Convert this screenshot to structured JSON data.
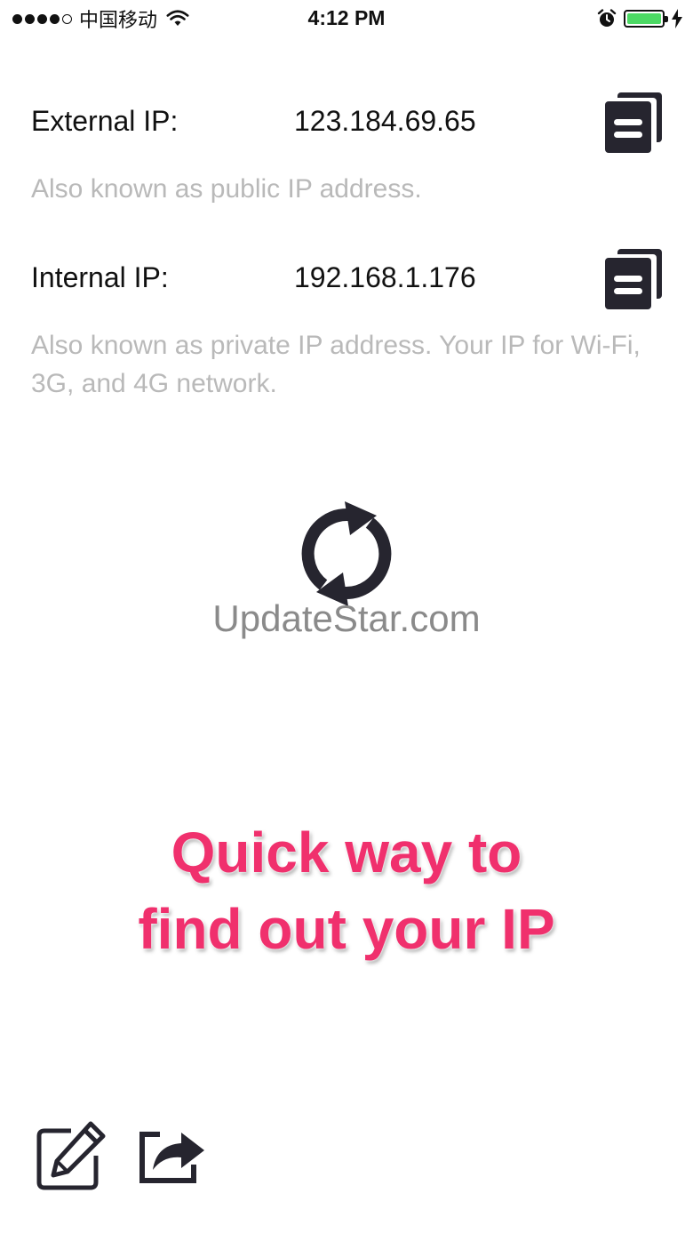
{
  "status_bar": {
    "carrier": "中国移动",
    "time": "4:12 PM",
    "signal_icon": "signal-dots-icon",
    "wifi_icon": "wifi-icon",
    "alarm_icon": "alarm-icon",
    "battery_icon": "battery-icon",
    "charging_icon": "charging-bolt-icon",
    "battery_color": "#4cd964"
  },
  "external": {
    "label": "External IP:",
    "value": "123.184.69.65",
    "description": "Also known as public IP address.",
    "copy_icon": "copy-icon"
  },
  "internal": {
    "label": "Internal IP:",
    "value": "192.168.1.176",
    "description": "Also known as private IP address. Your IP for Wi-Fi, 3G, and 4G network.",
    "copy_icon": "copy-icon"
  },
  "refresh_icon": "refresh-icon",
  "watermark": "UpdateStar.com",
  "promo": {
    "line1": "Quick way to",
    "line2": "find out your IP",
    "color": "#f0306d"
  },
  "toolbar": {
    "edit_icon": "edit-icon",
    "share_icon": "share-icon"
  },
  "colors": {
    "icon_dark": "#26252f",
    "description_gray": "#b9b9b9"
  }
}
